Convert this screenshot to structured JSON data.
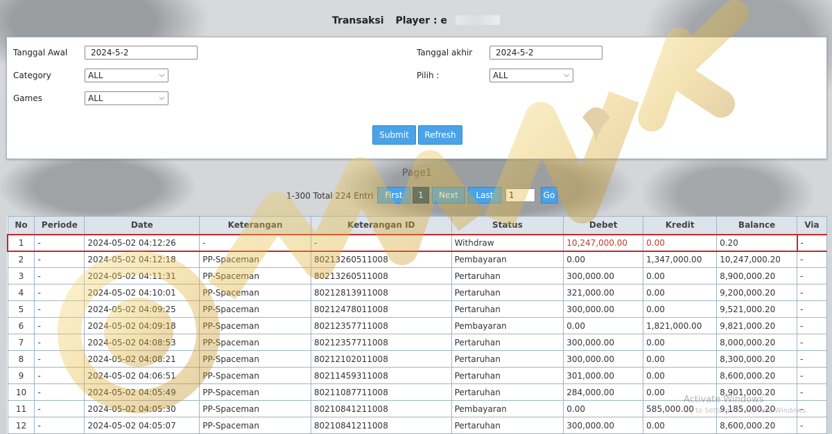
{
  "header": {
    "title": "Transaksi",
    "player_label": "Player : e"
  },
  "filters": {
    "tanggal_awal_label": "Tanggal Awal",
    "tanggal_awal_value": "2024-5-2",
    "tanggal_akhir_label": "Tanggal akhir",
    "tanggal_akhir_value": "2024-5-2",
    "category_label": "Category",
    "category_value": "ALL",
    "pilih_label": "Pilih :",
    "pilih_value": "ALL",
    "games_label": "Games",
    "games_value": "ALL",
    "submit_label": "Submit",
    "refresh_label": "Refresh"
  },
  "pager": {
    "title": "Page1",
    "total": "1-300 Total 224 Entri",
    "first": "First",
    "page": "1",
    "next": "Next",
    "last": "Last",
    "input_value": "1",
    "go": "Go"
  },
  "table": {
    "headers": [
      "No",
      "Periode",
      "Date",
      "Keterangan",
      "Keterangan ID",
      "Status",
      "Debet",
      "Kredit",
      "Balance",
      "Via"
    ],
    "rows": [
      [
        "1",
        "-",
        "2024-05-02 04:12:26",
        "-",
        "-",
        "Withdraw",
        "10,247,000.00",
        "0.00",
        "0.20",
        "-"
      ],
      [
        "2",
        "-",
        "2024-05-02 04:12:18",
        "PP-Spaceman",
        "80213260511008",
        "Pembayaran",
        "0.00",
        "1,347,000.00",
        "10,247,000.20",
        "-"
      ],
      [
        "3",
        "-",
        "2024-05-02 04:11:31",
        "PP-Spaceman",
        "80213260511008",
        "Pertaruhan",
        "300,000.00",
        "0.00",
        "8,900,000.20",
        "-"
      ],
      [
        "4",
        "-",
        "2024-05-02 04:10:01",
        "PP-Spaceman",
        "80212813911008",
        "Pertaruhan",
        "321,000.00",
        "0.00",
        "9,200,000.20",
        "-"
      ],
      [
        "5",
        "-",
        "2024-05-02 04:09:25",
        "PP-Spaceman",
        "80212478011008",
        "Pertaruhan",
        "300,000.00",
        "0.00",
        "9,521,000.20",
        "-"
      ],
      [
        "6",
        "-",
        "2024-05-02 04:09:18",
        "PP-Spaceman",
        "80212357711008",
        "Pembayaran",
        "0.00",
        "1,821,000.00",
        "9,821,000.20",
        "-"
      ],
      [
        "7",
        "-",
        "2024-05-02 04:08:53",
        "PP-Spaceman",
        "80212357711008",
        "Pertaruhan",
        "300,000.00",
        "0.00",
        "8,000,000.20",
        "-"
      ],
      [
        "8",
        "-",
        "2024-05-02 04:08:21",
        "PP-Spaceman",
        "80212102011008",
        "Pertaruhan",
        "300,000.00",
        "0.00",
        "8,300,000.20",
        "-"
      ],
      [
        "9",
        "-",
        "2024-05-02 04:06:51",
        "PP-Spaceman",
        "80211459311008",
        "Pertaruhan",
        "301,000.00",
        "0.00",
        "8,600,000.20",
        "-"
      ],
      [
        "10",
        "-",
        "2024-05-02 04:05:49",
        "PP-Spaceman",
        "80211087711008",
        "Pertaruhan",
        "284,000.00",
        "0.00",
        "8,901,000.20",
        "-"
      ],
      [
        "11",
        "-",
        "2024-05-02 04:05:30",
        "PP-Spaceman",
        "80210841211008",
        "Pembayaran",
        "0.00",
        "585,000.00",
        "9,185,000.20",
        "-"
      ],
      [
        "12",
        "-",
        "2024-05-02 04:05:07",
        "PP-Spaceman",
        "80210841211008",
        "Pertaruhan",
        "300,000.00",
        "0.00",
        "8,600,000.20",
        "-"
      ]
    ]
  },
  "watermark": {
    "line1": "Activate Windows",
    "line2": "Go to Settings to activate Windows."
  },
  "colors": {
    "accent": "#4aa3e8",
    "active_page": "#1e4f7a",
    "highlight_border": "#c0282d",
    "debit_red": "#c0392b",
    "logo_gold": "#e3b53a"
  }
}
